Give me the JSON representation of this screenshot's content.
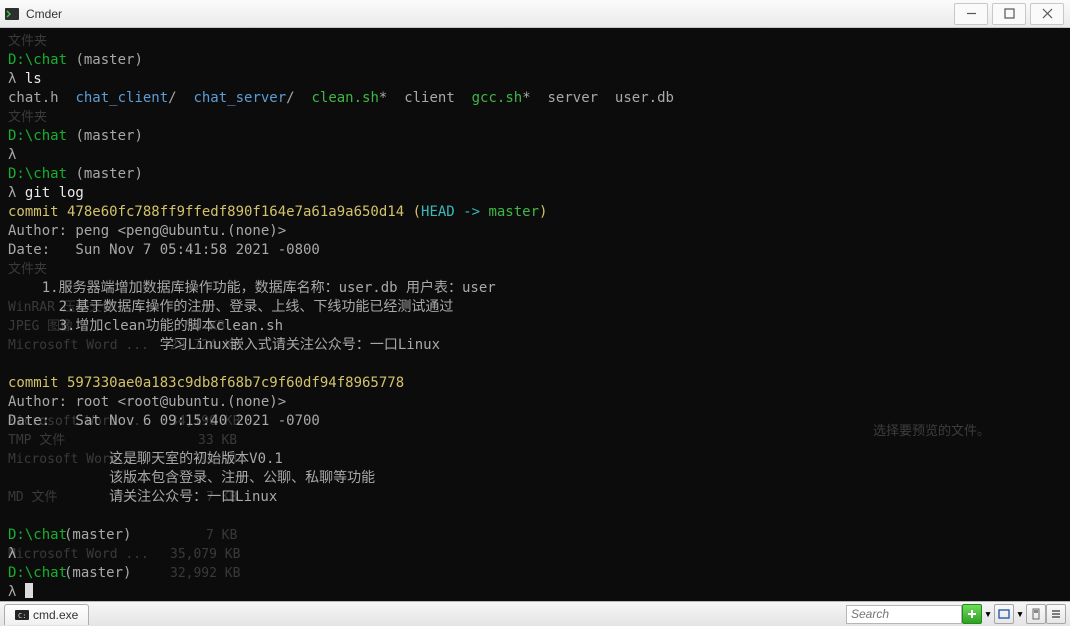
{
  "window": {
    "title": "Cmder"
  },
  "ghost": {
    "r1": "文件夹",
    "r2": "文件夹",
    "r3": "文件夹",
    "r4_a": "WinRAR 压缩文件",
    "r5_a": "JPEG 图像",
    "r5_b": "51 KB",
    "r6_a": "Microsoft Word ...",
    "r6_b": "29,724 KB",
    "r7_a": "Microsoft Word ...",
    "r7_b": "34,190 KB",
    "r8_a": "TMP 文件",
    "r8_b": "33 KB",
    "r9_a": "Microsoft Word ...",
    "r9_b": "33 KB",
    "r10_a": "MD 文件",
    "r10_b": "7 KB",
    "r11_a": "",
    "r11_b": "7 KB",
    "r12_a": "Microsoft Word ...",
    "r12_b": "35,079 KB",
    "r13_a": "",
    "r13_b": "32,992 KB",
    "preview": "选择要预览的文件。"
  },
  "term": {
    "p1_path": "D:\\chat ",
    "p1_branch": "(master)",
    "lambda": "λ ",
    "cmd_ls": "ls",
    "ls_w1": "chat.h  ",
    "ls_b1": "chat_client",
    "ls_w2": "/  ",
    "ls_b2": "chat_server",
    "ls_w3": "/  ",
    "ls_g1": "clean.sh",
    "ls_w4": "*  client  ",
    "ls_g2": "gcc.sh",
    "ls_w5": "*  server  user.db",
    "cmd_gitlog": "git log",
    "c1_hash_a": "commit 478e60fc788ff9ffedf890f164e7a61a9a650d14 (",
    "c1_head": "HEAD -> ",
    "c1_master": "master",
    "c1_hash_b": ")",
    "c1_author": "Author: peng <peng@ubuntu.(none)>",
    "c1_date": "Date:   Sun Nov 7 05:41:58 2021 -0800",
    "c1_m1": "    1.服务器端增加数据库操作功能，数据库名称：user.db 用户表：user",
    "c1_m2": "      2.基于数据库操作的注册、登录、上线、下线功能已经测试通过",
    "c1_m3": "      3.增加clean功能的脚本clean.sh",
    "c1_m4": "                  学习Linux嵌入式请关注公众号：一口Linux",
    "c2_hash": "commit 597330ae0a183c9db8f68b7c9f60df94f8965778",
    "c2_author": "Author: root <root@ubuntu.(none)>",
    "c2_date": "Date:   Sat Nov 6 09:15:40 2021 -0700",
    "c2_m1": "            这是聊天室的初始版本V0.1",
    "c2_m2": "            该版本包含登录、注册、公聊、私聊等功能",
    "c2_m3": "            请关注公众号：一口Linux"
  },
  "status": {
    "tab_label": "cmd.exe",
    "search_placeholder": "Search"
  }
}
